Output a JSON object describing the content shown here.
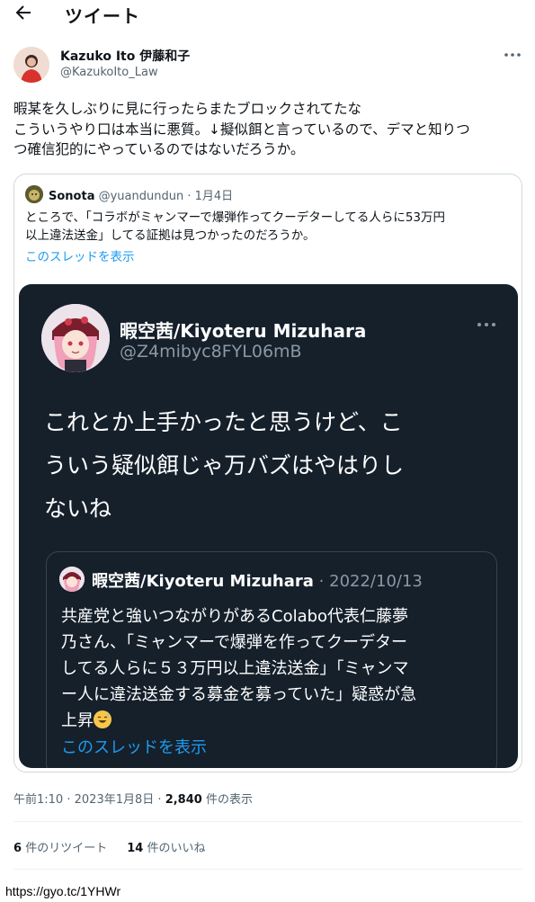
{
  "header": {
    "back_icon": "arrow-left-icon",
    "title": "ツイート"
  },
  "author": {
    "name": "Kazuko Ito 伊藤和子",
    "handle": "@KazukoIto_Law"
  },
  "tweet": {
    "lines": [
      "暇某を久しぶりに見に行ったらまたブロックされてたな",
      "こういうやり口は本当に悪質。↓擬似餌と言っているので、デマと知りつ",
      "つ確信犯的にやっているのではないだろうか。"
    ]
  },
  "quote": {
    "name": "Sonota",
    "handle": "@yuandundun",
    "dot": "·",
    "date": "1月4日",
    "lines": [
      "ところで、「コラボがミャンマーで爆弾作ってクーデターしてる人らに53万円",
      "以上違法送金」してる証拠は見つかったのだろうか。"
    ],
    "thread_link": "このスレッドを表示",
    "screenshot": {
      "name": "暇空茜/Kiyoteru Mizuhara",
      "handle": "@Z4mibyc8FYL06mB",
      "lines": [
        "これとか上手かったと思うけど、こ",
        "ういう疑似餌じゃ万バズはやはりし",
        "ないね"
      ],
      "inner": {
        "name": "暇空茜/Kiyoteru Mizuhara",
        "dot": "·",
        "date": "2022/10/13",
        "lines": [
          "共産党と強いつながりがあるColabo代表仁藤夢",
          "乃さん、「ミャンマーで爆弾を作ってクーデター",
          "してる人らに５３万円以上違法送金」「ミャンマ",
          "ー人に違法送金する募金を募っていた」疑惑が急",
          "上昇"
        ],
        "emoji": "sweat-smile-emoji",
        "thread_link": "このスレッドを表示"
      }
    }
  },
  "meta": {
    "time": "午前1:10",
    "dot": "·",
    "date": "2023年1月8日",
    "views_count": "2,840",
    "views_label": "件の表示"
  },
  "stats": {
    "retweets_count": "6",
    "retweets_label": "件のリツイート",
    "likes_count": "14",
    "likes_label": "件のいいね"
  },
  "footer_url": "https://gyo.tc/1YHWr"
}
